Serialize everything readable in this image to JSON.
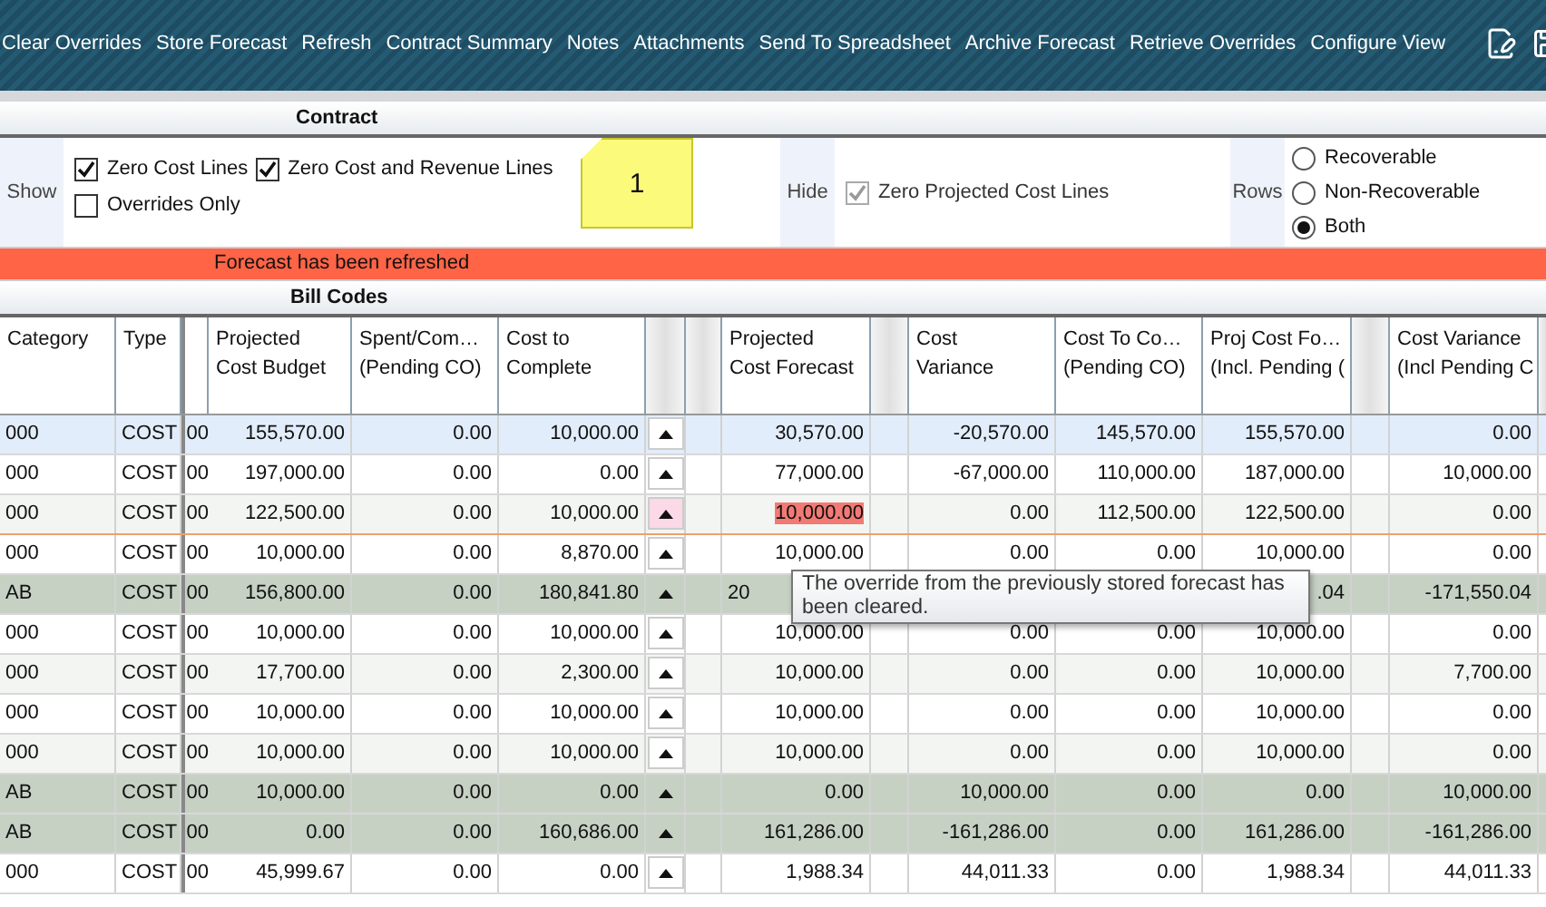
{
  "toolbar": {
    "items": [
      "Clear Overrides",
      "Store Forecast",
      "Refresh",
      "Contract Summary",
      "Notes",
      "Attachments",
      "Send To Spreadsheet",
      "Archive Forecast",
      "Retrieve Overrides",
      "Configure View"
    ]
  },
  "contract_header": "Contract",
  "show": {
    "label": "Show",
    "options": [
      {
        "label": "Zero Cost Lines",
        "checked": true
      },
      {
        "label": "Zero Cost and Revenue Lines",
        "checked": true
      },
      {
        "label": "Overrides Only",
        "checked": false
      }
    ]
  },
  "note": "1",
  "hide": {
    "label": "Hide",
    "options": [
      {
        "label": "Zero Projected Cost Lines",
        "checked": true,
        "disabled": true
      }
    ]
  },
  "rows_filter": {
    "label": "Rows",
    "options": [
      {
        "label": "Recoverable",
        "selected": false
      },
      {
        "label": "Non-Recoverable",
        "selected": false
      },
      {
        "label": "Both",
        "selected": true
      }
    ]
  },
  "message": "Forecast has been refreshed",
  "grid_title": "Bill Codes",
  "columns": [
    {
      "kind": "label",
      "lines": [
        "Category"
      ]
    },
    {
      "kind": "label",
      "lines": [
        "Type"
      ]
    },
    {
      "kind": "frozen"
    },
    {
      "kind": "amount",
      "lines": [
        "Projected",
        "Cost Budget"
      ]
    },
    {
      "kind": "amount",
      "lines": [
        "Spent/Com…",
        "(Pending CO)"
      ]
    },
    {
      "kind": "amount",
      "lines": [
        "Cost to",
        "Complete"
      ]
    },
    {
      "kind": "arrow"
    },
    {
      "kind": "blank"
    },
    {
      "kind": "amount",
      "lines": [
        "Projected",
        "Cost Forecast"
      ]
    },
    {
      "kind": "blank"
    },
    {
      "kind": "amount",
      "lines": [
        "Cost",
        "Variance"
      ]
    },
    {
      "kind": "amount",
      "lines": [
        "Cost To Co…",
        "(Pending CO)"
      ]
    },
    {
      "kind": "amount",
      "lines": [
        "Proj Cost Fo…",
        "(Incl. Pending ("
      ]
    },
    {
      "kind": "blank"
    },
    {
      "kind": "amount",
      "lines": [
        "Cost Variance",
        "(Incl Pending C"
      ]
    },
    {
      "kind": "blank"
    }
  ],
  "rows": [
    {
      "kind": "detail",
      "selected": true,
      "override": false,
      "cells": [
        "000",
        "COST",
        "00",
        "155,570.00",
        "0.00",
        "10,000.00",
        "30,570.00",
        "-20,570.00",
        "145,570.00",
        "155,570.00",
        "0.00"
      ]
    },
    {
      "kind": "detail",
      "selected": false,
      "override": false,
      "cells": [
        "000",
        "COST",
        "00",
        "197,000.00",
        "0.00",
        "0.00",
        "77,000.00",
        "-67,000.00",
        "110,000.00",
        "187,000.00",
        "10,000.00"
      ]
    },
    {
      "kind": "detail",
      "selected": false,
      "override": true,
      "cells": [
        "000",
        "COST",
        "00",
        "122,500.00",
        "0.00",
        "10,000.00",
        "10,000.00",
        "0.00",
        "112,500.00",
        "122,500.00",
        "0.00"
      ]
    },
    {
      "kind": "detail",
      "selected": false,
      "override": false,
      "cells": [
        "000",
        "COST",
        "00",
        "10,000.00",
        "0.00",
        "8,870.00",
        "10,000.00",
        "0.00",
        "0.00",
        "10,000.00",
        "0.00"
      ]
    },
    {
      "kind": "total",
      "selected": false,
      "override": false,
      "cells": [
        "AB",
        "COST",
        "00",
        "156,800.00",
        "0.00",
        "180,841.80",
        {
          "text": "20",
          "cut_right": true
        },
        null,
        null,
        {
          "text": ".04",
          "cut_right": false
        },
        "-171,550.04"
      ]
    },
    {
      "kind": "detail",
      "selected": false,
      "override": false,
      "cells": [
        "000",
        "COST",
        "00",
        "10,000.00",
        "0.00",
        "10,000.00",
        "10,000.00",
        "0.00",
        "0.00",
        "10,000.00",
        "0.00"
      ]
    },
    {
      "kind": "detail",
      "selected": false,
      "override": false,
      "cells": [
        "000",
        "COST",
        "00",
        "17,700.00",
        "0.00",
        "2,300.00",
        "10,000.00",
        "0.00",
        "0.00",
        "10,000.00",
        "7,700.00"
      ]
    },
    {
      "kind": "detail",
      "selected": false,
      "override": false,
      "cells": [
        "000",
        "COST",
        "00",
        "10,000.00",
        "0.00",
        "10,000.00",
        "10,000.00",
        "0.00",
        "0.00",
        "10,000.00",
        "0.00"
      ]
    },
    {
      "kind": "detail",
      "selected": false,
      "override": false,
      "cells": [
        "000",
        "COST",
        "00",
        "10,000.00",
        "0.00",
        "10,000.00",
        "10,000.00",
        "0.00",
        "0.00",
        "10,000.00",
        "0.00"
      ]
    },
    {
      "kind": "total",
      "selected": false,
      "override": false,
      "cells": [
        "AB",
        "COST",
        "00",
        "10,000.00",
        "0.00",
        "0.00",
        "0.00",
        "10,000.00",
        "0.00",
        "0.00",
        "10,000.00"
      ]
    },
    {
      "kind": "total",
      "selected": false,
      "override": false,
      "cells": [
        "AB",
        "COST",
        "00",
        "0.00",
        "0.00",
        "160,686.00",
        "161,286.00",
        "-161,286.00",
        "0.00",
        "161,286.00",
        "-161,286.00"
      ]
    },
    {
      "kind": "detail",
      "selected": false,
      "override": false,
      "cells": [
        "000",
        "COST",
        "00",
        "45,999.67",
        "0.00",
        "0.00",
        "1,988.34",
        "44,011.33",
        "0.00",
        "1,988.34",
        "44,011.33"
      ]
    }
  ],
  "tooltip": "The override from the previously stored forecast has been cleared."
}
